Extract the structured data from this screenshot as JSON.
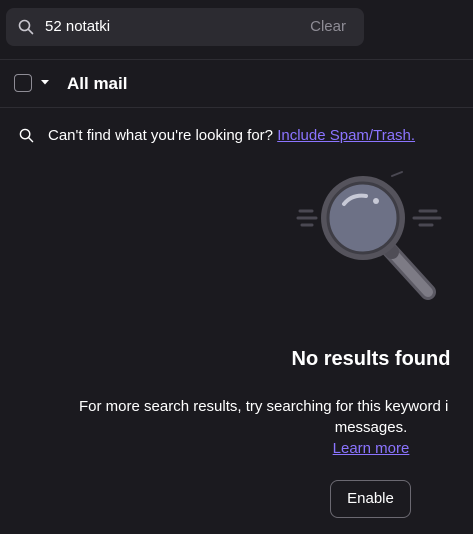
{
  "search": {
    "value": "52 notatki",
    "clear_label": "Clear",
    "icon": "search-icon"
  },
  "toolbar": {
    "folder_title": "All mail",
    "select_all_icon": "checkbox-icon",
    "dropdown_icon": "caret-down-icon"
  },
  "hint": {
    "icon": "search-icon",
    "text": "Can't find what you're looking for?",
    "link_label": "Include Spam/Trash."
  },
  "empty_state": {
    "illustration": "magnifying-glass-illustration",
    "title": "No results found",
    "description_line1": "For more search results, try searching for this keyword i",
    "description_line2": "messages.",
    "learn_more_label": "Learn more",
    "enable_label": "Enable"
  },
  "colors": {
    "background": "#1b1a1f",
    "search_background": "#2c2b31",
    "link": "#8b74ff",
    "muted_text": "#8e8c95",
    "divider": "#2e2d33"
  }
}
